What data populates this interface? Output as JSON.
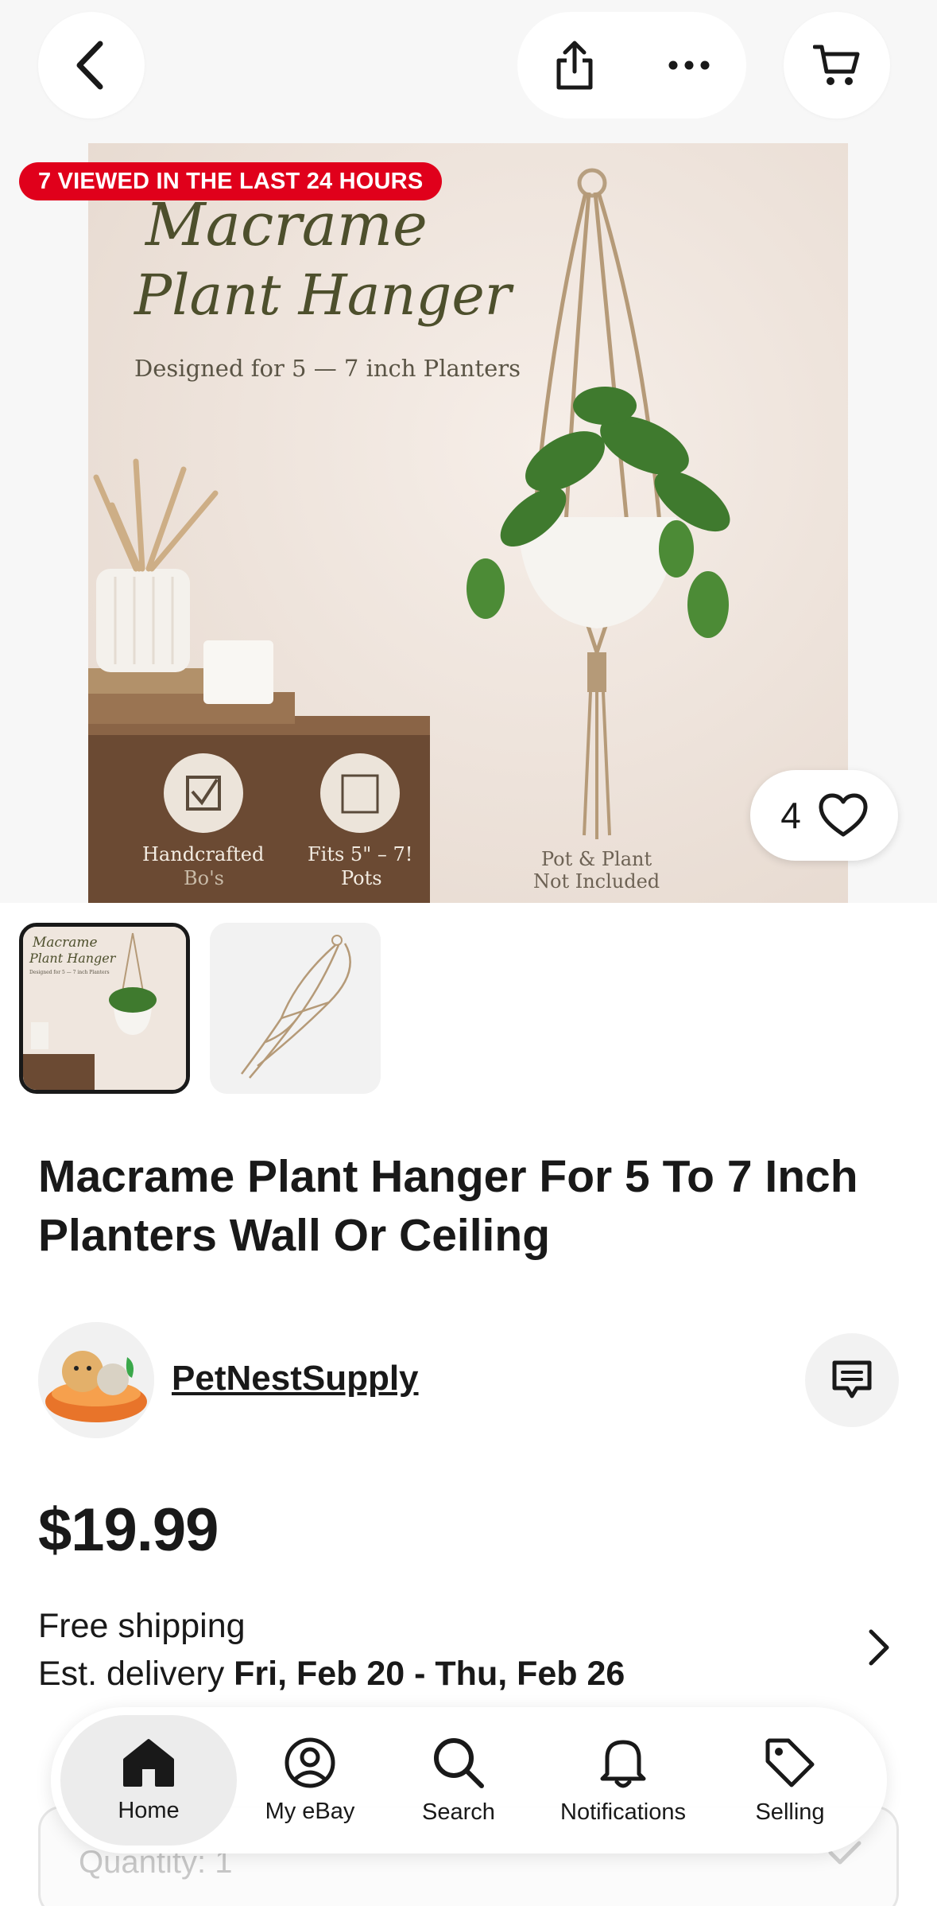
{
  "header": {
    "back_icon": "chevron-left-icon",
    "share_icon": "share-icon",
    "more_icon": "more-horizontal-icon",
    "cart_icon": "cart-icon"
  },
  "hero": {
    "badge": "7 VIEWED IN THE LAST 24 HOURS",
    "image_title_line1": "Macrame",
    "image_title_line2": "Plant Hanger",
    "image_subtitle": "Designed for 5 — 7 inch Planters",
    "feature1": "Handcrafted",
    "feature1_sub": "Bo's",
    "feature2": "Fits 5\" – 7!",
    "feature2_sub": "Pots",
    "feature3_line1": "Pot & Plant",
    "feature3_line2": "Not Included",
    "watchers_count": "4",
    "heart_icon": "heart-icon"
  },
  "thumbnails": [
    {
      "alt": "thumbnail-1",
      "title_line1": "Macrame",
      "title_line2": "Plant Hanger",
      "subtitle": "Designed for 5 — 7 inch Planters"
    },
    {
      "alt": "thumbnail-2"
    }
  ],
  "listing": {
    "title": "Macrame Plant Hanger For 5 To 7 Inch Planters Wall Or Ceiling",
    "seller": "PetNestSupply",
    "price": "$19.99",
    "shipping": "Free shipping",
    "delivery_prefix": "Est. delivery ",
    "delivery_dates": "Fri, Feb 20 - Thu, Feb 26",
    "quantity_label": "Quantity:",
    "quantity_value": "1"
  },
  "colors": {
    "badge_red": "#e0001b",
    "text": "#191919",
    "active_nav_bg": "#ececec"
  },
  "nav": [
    {
      "label": "Home",
      "icon": "home-icon",
      "active": true
    },
    {
      "label": "My eBay",
      "icon": "user-circle-icon",
      "active": false
    },
    {
      "label": "Search",
      "icon": "search-icon",
      "active": false
    },
    {
      "label": "Notifications",
      "icon": "bell-icon",
      "active": false
    },
    {
      "label": "Selling",
      "icon": "tag-icon",
      "active": false
    }
  ]
}
